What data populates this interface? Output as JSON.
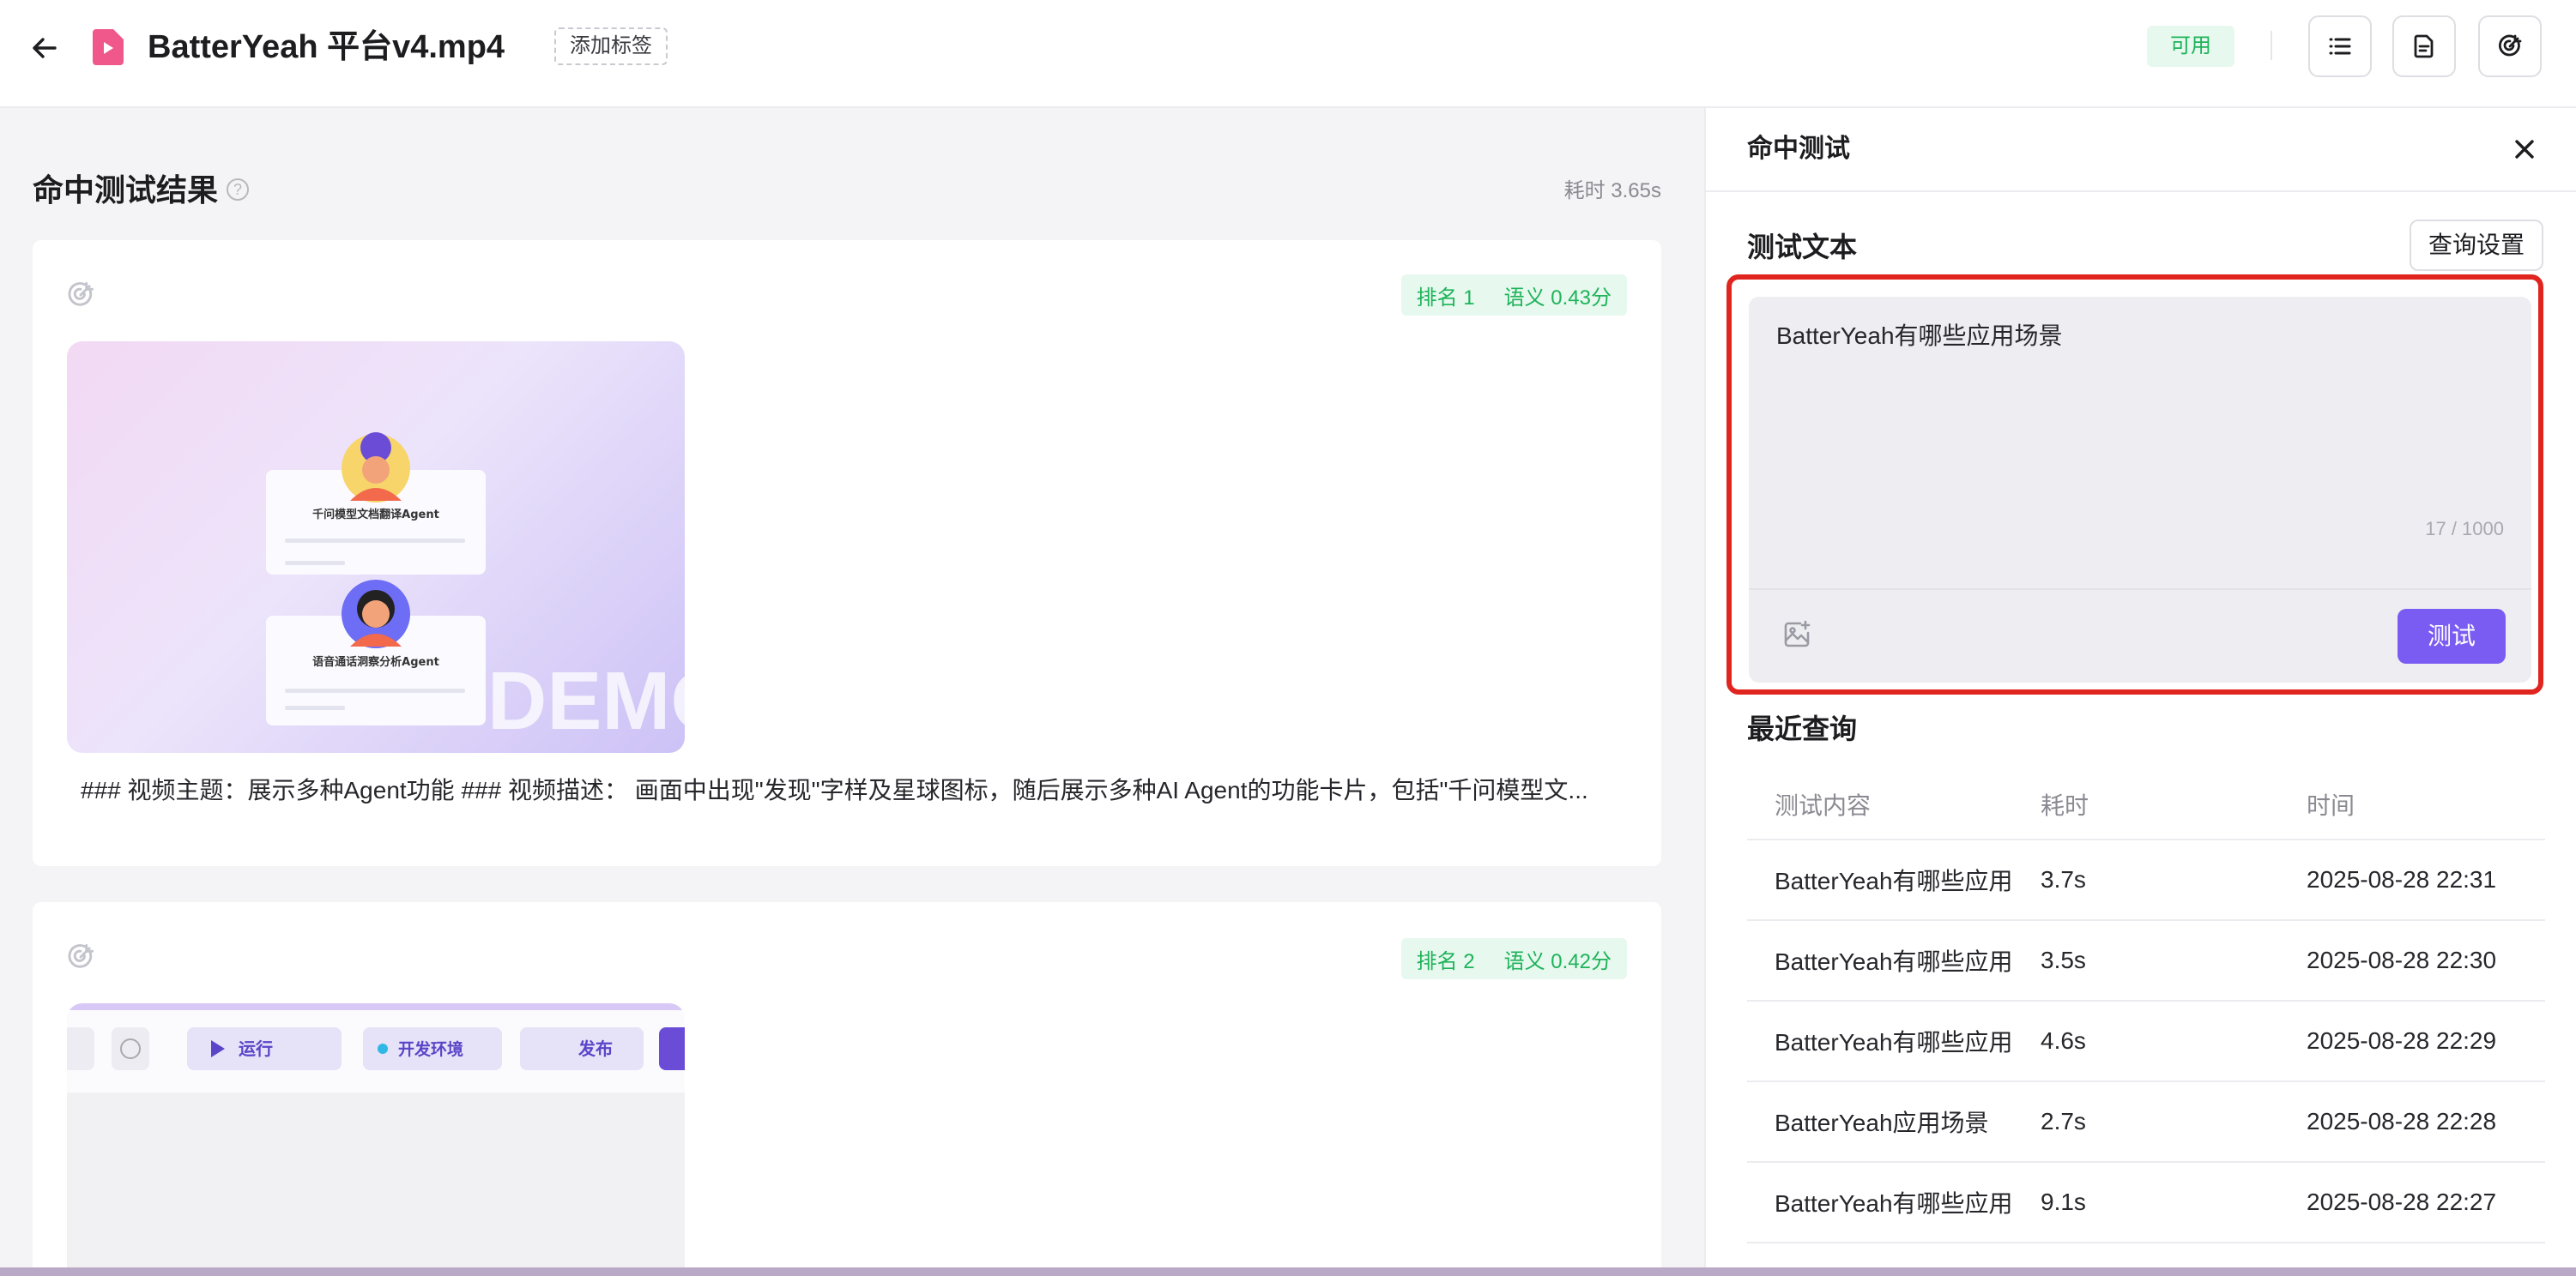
{
  "header": {
    "file_name": "BatterYeah 平台v4.mp4",
    "add_tag_label": "添加标签",
    "status": "可用",
    "icons": [
      "back-arrow-icon",
      "video-file-icon",
      "list-icon",
      "document-icon",
      "target-icon"
    ]
  },
  "results": {
    "title": "命中测试结果",
    "elapsed": "耗时 3.65s",
    "items": [
      {
        "rank": "排名 1",
        "score": "语义 0.43分",
        "description": "### 视频主题：展示多种Agent功能 ### 视频描述： 画面中出现\"发现\"字样及星球图标，随后展示多种AI Agent的功能卡片，包括\"千问模型文...",
        "thumb": {
          "card1_label": "千问模型文档翻译Agent",
          "card2_label": "语音通话洞察分析Agent",
          "watermark": "DEMO"
        }
      },
      {
        "rank": "排名 2",
        "score": "语义 0.42分",
        "thumb": {
          "run_label": "运行",
          "env_label": "开发环境",
          "publish_label": "发布"
        }
      }
    ]
  },
  "hit_test": {
    "panel_title": "命中测试",
    "section_title": "测试文本",
    "query_settings_label": "查询设置",
    "input_text": "BatterYeah有哪些应用场景",
    "char_count": "17 / 1000",
    "test_button_label": "测试",
    "recent_title": "最近查询",
    "columns": [
      "测试内容",
      "耗时",
      "时间"
    ],
    "rows": [
      {
        "content": "BatterYeah有哪些应用",
        "duration": "3.7s",
        "time": "2025-08-28 22:31"
      },
      {
        "content": "BatterYeah有哪些应用",
        "duration": "3.5s",
        "time": "2025-08-28 22:30"
      },
      {
        "content": "BatterYeah有哪些应用",
        "duration": "4.6s",
        "time": "2025-08-28 22:29"
      },
      {
        "content": "BatterYeah应用场景",
        "duration": "2.7s",
        "time": "2025-08-28 22:28"
      },
      {
        "content": "BatterYeah有哪些应用",
        "duration": "9.1s",
        "time": "2025-08-28 22:27"
      }
    ]
  },
  "colors": {
    "accent": "#7a5cf2",
    "success": "#1eb35a",
    "highlight": "#e0241e",
    "file_icon": "#f0578a"
  }
}
